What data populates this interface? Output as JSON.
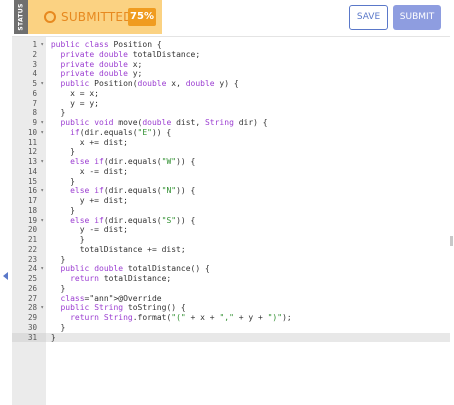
{
  "status": {
    "side_label": "STATUS",
    "state_label": "SUBMITTED",
    "percent": "75%"
  },
  "actions": {
    "save_label": "SAVE",
    "submit_label": "SUBMIT"
  },
  "colors": {
    "submitted_bg": "#fbd282",
    "submitted_text": "#e7891f",
    "percent_badge": "#f09c20",
    "accent": "#5a78c9",
    "submit_bg": "#8e9de0",
    "keyword": "#9b3dd1",
    "string": "#2f8f2f"
  },
  "editor": {
    "active_line": 31,
    "lines": [
      {
        "n": "1",
        "fold": true,
        "code": "public class Position {"
      },
      {
        "n": "2",
        "fold": false,
        "code": "  private double totalDistance;"
      },
      {
        "n": "3",
        "fold": false,
        "code": "  private double x;"
      },
      {
        "n": "4",
        "fold": false,
        "code": "  private double y;"
      },
      {
        "n": "5",
        "fold": true,
        "code": "  public Position(double x, double y) {"
      },
      {
        "n": "6",
        "fold": false,
        "code": "    x = x;"
      },
      {
        "n": "7",
        "fold": false,
        "code": "    y = y;"
      },
      {
        "n": "8",
        "fold": false,
        "code": "  }"
      },
      {
        "n": "9",
        "fold": true,
        "code": "  public void move(double dist, String dir) {"
      },
      {
        "n": "10",
        "fold": true,
        "code": "    if(dir.equals(\"E\")) {"
      },
      {
        "n": "11",
        "fold": false,
        "code": "      x += dist;"
      },
      {
        "n": "12",
        "fold": false,
        "code": "    }"
      },
      {
        "n": "13",
        "fold": true,
        "code": "    else if(dir.equals(\"W\")) {"
      },
      {
        "n": "14",
        "fold": false,
        "code": "      x -= dist;"
      },
      {
        "n": "15",
        "fold": false,
        "code": "    }"
      },
      {
        "n": "16",
        "fold": true,
        "code": "    else if(dir.equals(\"N\")) {"
      },
      {
        "n": "17",
        "fold": false,
        "code": "      y += dist;"
      },
      {
        "n": "18",
        "fold": false,
        "code": "    }"
      },
      {
        "n": "19",
        "fold": true,
        "code": "    else if(dir.equals(\"S\")) {"
      },
      {
        "n": "20",
        "fold": false,
        "code": "      y -= dist;"
      },
      {
        "n": "21",
        "fold": false,
        "code": "      }"
      },
      {
        "n": "22",
        "fold": false,
        "code": "      totalDistance += dist;"
      },
      {
        "n": "23",
        "fold": false,
        "code": "  }"
      },
      {
        "n": "24",
        "fold": true,
        "code": "  public double totalDistance() {"
      },
      {
        "n": "25",
        "fold": false,
        "code": "    return totalDistance;"
      },
      {
        "n": "26",
        "fold": false,
        "code": "  }"
      },
      {
        "n": "27",
        "fold": false,
        "code": "  @Override"
      },
      {
        "n": "28",
        "fold": true,
        "code": "  public String toString() {"
      },
      {
        "n": "29",
        "fold": false,
        "code": "    return String.format(\"(\" + x + \",\" + y + \")\");"
      },
      {
        "n": "30",
        "fold": false,
        "code": "  }"
      },
      {
        "n": "31",
        "fold": false,
        "code": "}"
      }
    ]
  }
}
